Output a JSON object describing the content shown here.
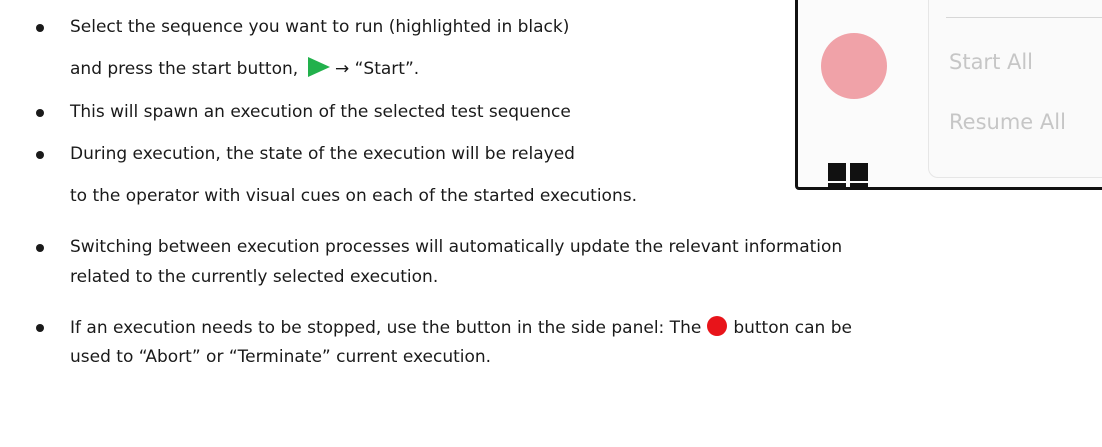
{
  "doc": {
    "b1_line1": "Select the sequence you want to run (highlighted in black)",
    "b1_line2_pre": "and press the start button, ",
    "b1_line2_post": "→ “Start”.",
    "b2": "This will spawn an execution of the selected test sequence",
    "b3_line1": "During execution, the state of the execution will be relayed",
    "b3_line2": "to the operator with visual cues on each of the started executions.",
    "b4_line1": "Switching between execution processes will automatically update the relevant information",
    "b4_line2": "related to the currently selected execution.",
    "b5_line1_pre": "If an execution needs to be stopped, use the button in the side panel: The",
    "b5_line1_post": "button can be",
    "b5_line2": "used to “Abort” or “Terminate” current execution."
  },
  "panel": {
    "start_all": "Start All",
    "resume_all": "Resume All"
  },
  "icons": {
    "start": "play-triangle-icon",
    "stop": "red-circle-icon",
    "status": "pink-circle-icon",
    "grid": "grid-squares-icon"
  },
  "colors": {
    "play": "#22b14c",
    "stop": "#e8141a",
    "status": "#f0a2a8"
  }
}
